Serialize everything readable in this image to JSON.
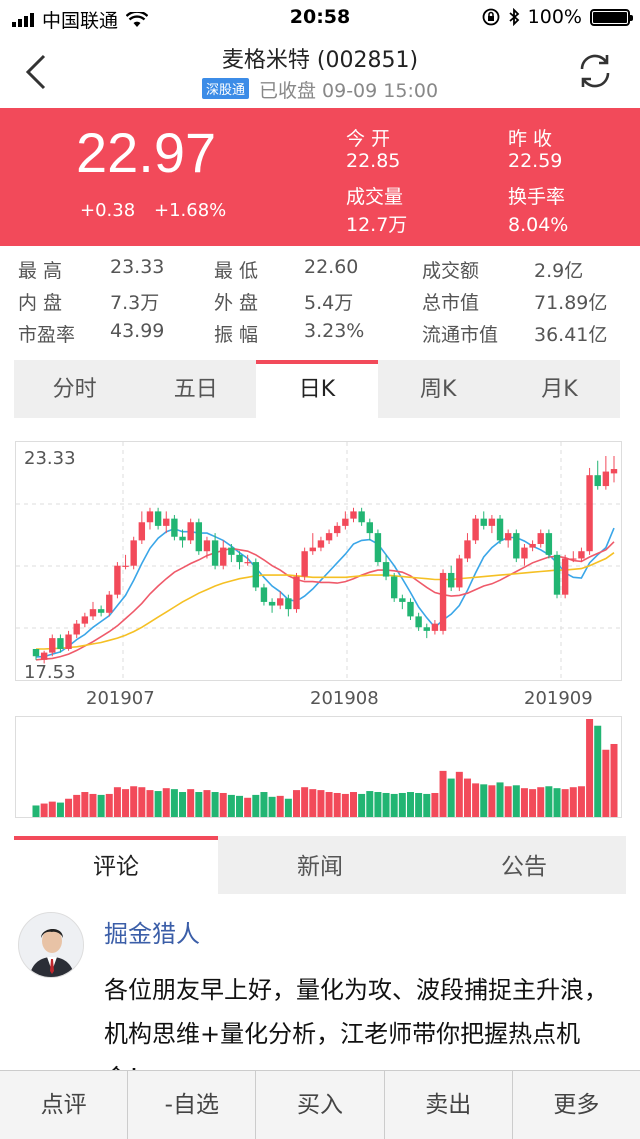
{
  "status_bar": {
    "carrier": "中国联通",
    "time": "20:58",
    "battery": "100%"
  },
  "header": {
    "title": "麦格米特 (002851)",
    "badge": "深股通",
    "subtitle": "已收盘 09-09 15:00"
  },
  "quote": {
    "price": "22.97",
    "change": "+0.38",
    "change_pct": "+1.68%",
    "open_label": "今 开",
    "open": "22.85",
    "prev_close_label": "昨 收",
    "prev_close": "22.59",
    "volume_label": "成交量",
    "volume": "12.7万",
    "turnover_label": "换手率",
    "turnover": "8.04%"
  },
  "stats": [
    {
      "label": "最 高",
      "value": "23.33"
    },
    {
      "label": "最 低",
      "value": "22.60"
    },
    {
      "label": "成交额",
      "value": "2.9亿"
    },
    {
      "label": "内 盘",
      "value": "7.3万"
    },
    {
      "label": "外 盘",
      "value": "5.4万"
    },
    {
      "label": "总市值",
      "value": "71.89亿"
    },
    {
      "label": "市盈率",
      "value": "43.99"
    },
    {
      "label": "振 幅",
      "value": "3.23%"
    },
    {
      "label": "流通市值",
      "value": "36.41亿"
    }
  ],
  "chart_tabs": [
    "分时",
    "五日",
    "日K",
    "周K",
    "月K"
  ],
  "chart_data": {
    "type": "candlestick",
    "y_max_label": "23.33",
    "y_min_label": "17.53",
    "ylim": [
      17.53,
      23.33
    ],
    "x_tick_labels": [
      "201907",
      "201908",
      "201909"
    ],
    "candles": [
      [
        18.0,
        17.8,
        17.9,
        17.7
      ],
      [
        17.7,
        17.9,
        17.95,
        17.6
      ],
      [
        17.9,
        18.3,
        18.4,
        17.8
      ],
      [
        18.3,
        18.0,
        18.4,
        17.9
      ],
      [
        18.0,
        18.4,
        18.5,
        17.95
      ],
      [
        18.4,
        18.7,
        18.8,
        18.3
      ],
      [
        18.7,
        18.9,
        19.0,
        18.6
      ],
      [
        18.9,
        19.1,
        19.3,
        18.8
      ],
      [
        19.1,
        19.0,
        19.2,
        18.9
      ],
      [
        19.0,
        19.5,
        19.6,
        18.9
      ],
      [
        19.5,
        20.3,
        20.4,
        19.4
      ],
      [
        20.3,
        20.3,
        20.6,
        20.2
      ],
      [
        20.3,
        21.0,
        21.1,
        20.2
      ],
      [
        21.0,
        21.5,
        21.8,
        20.9
      ],
      [
        21.5,
        21.8,
        21.9,
        21.3
      ],
      [
        21.8,
        21.4,
        21.9,
        21.3
      ],
      [
        21.4,
        21.6,
        21.8,
        21.2
      ],
      [
        21.6,
        21.1,
        21.7,
        21.0
      ],
      [
        21.1,
        21.0,
        21.3,
        20.8
      ],
      [
        21.0,
        21.5,
        21.6,
        20.9
      ],
      [
        21.5,
        20.7,
        21.6,
        20.6
      ],
      [
        20.7,
        21.0,
        21.1,
        20.5
      ],
      [
        21.0,
        20.3,
        21.2,
        20.2
      ],
      [
        20.3,
        20.8,
        21.0,
        20.2
      ],
      [
        20.8,
        20.6,
        20.9,
        20.4
      ],
      [
        20.6,
        20.4,
        20.7,
        20.2
      ],
      [
        20.4,
        20.4,
        20.6,
        20.3
      ],
      [
        20.4,
        19.7,
        20.5,
        19.6
      ],
      [
        19.7,
        19.3,
        19.8,
        19.2
      ],
      [
        19.3,
        19.2,
        19.4,
        19.0
      ],
      [
        19.2,
        19.4,
        19.6,
        19.1
      ],
      [
        19.4,
        19.1,
        19.5,
        18.9
      ],
      [
        19.1,
        20.0,
        20.1,
        19.0
      ],
      [
        20.0,
        20.7,
        20.8,
        19.9
      ],
      [
        20.7,
        20.8,
        21.2,
        20.6
      ],
      [
        20.8,
        21.0,
        21.1,
        20.7
      ],
      [
        21.0,
        21.2,
        21.3,
        20.9
      ],
      [
        21.2,
        21.4,
        21.5,
        21.1
      ],
      [
        21.4,
        21.6,
        21.8,
        21.3
      ],
      [
        21.6,
        21.8,
        21.9,
        21.5
      ],
      [
        21.8,
        21.5,
        21.9,
        21.4
      ],
      [
        21.5,
        21.2,
        21.6,
        21.0
      ],
      [
        21.2,
        20.4,
        21.3,
        20.3
      ],
      [
        20.4,
        20.0,
        20.6,
        19.9
      ],
      [
        20.0,
        19.4,
        20.1,
        19.3
      ],
      [
        19.4,
        19.3,
        19.5,
        19.1
      ],
      [
        19.3,
        18.9,
        19.4,
        18.8
      ],
      [
        18.9,
        18.6,
        19.0,
        18.5
      ],
      [
        18.6,
        18.5,
        18.7,
        18.3
      ],
      [
        18.5,
        18.7,
        18.8,
        18.4
      ],
      [
        18.5,
        20.1,
        20.2,
        18.4
      ],
      [
        20.1,
        19.7,
        20.3,
        19.6
      ],
      [
        19.7,
        20.5,
        20.6,
        19.6
      ],
      [
        20.5,
        21.0,
        21.2,
        20.4
      ],
      [
        21.0,
        21.6,
        21.7,
        20.9
      ],
      [
        21.6,
        21.4,
        21.8,
        21.3
      ],
      [
        21.4,
        21.6,
        21.7,
        21.2
      ],
      [
        21.6,
        21.0,
        21.7,
        20.9
      ],
      [
        21.0,
        21.2,
        21.3,
        20.8
      ],
      [
        21.2,
        20.5,
        21.3,
        20.4
      ],
      [
        20.5,
        20.8,
        20.9,
        20.3
      ],
      [
        20.8,
        20.9,
        21.0,
        20.7
      ],
      [
        20.9,
        21.2,
        21.3,
        20.8
      ],
      [
        21.2,
        20.6,
        21.3,
        20.5
      ],
      [
        20.6,
        19.5,
        20.7,
        19.4
      ],
      [
        19.5,
        20.5,
        20.6,
        19.4
      ],
      [
        20.5,
        20.5,
        20.7,
        20.4
      ],
      [
        20.5,
        20.7,
        20.8,
        20.4
      ],
      [
        20.7,
        22.8,
        23.0,
        20.6
      ],
      [
        22.8,
        22.5,
        23.2,
        22.4
      ],
      [
        22.5,
        22.9,
        23.33,
        22.4
      ],
      [
        22.85,
        22.97,
        23.33,
        22.6
      ]
    ],
    "ma_lines": [
      {
        "color": "#3aa6e8",
        "values": [
          17.78,
          17.79,
          17.86,
          17.92,
          18.08,
          18.26,
          18.4,
          18.6,
          18.76,
          18.92,
          19.2,
          19.48,
          19.9,
          20.36,
          20.78,
          21.06,
          21.24,
          21.32,
          21.24,
          21.24,
          21.2,
          21.2,
          21.1,
          21.0,
          20.84,
          20.66,
          20.5,
          20.24,
          19.98,
          19.74,
          19.58,
          19.36,
          19.32,
          19.46,
          19.66,
          19.9,
          20.14,
          20.38,
          20.62,
          20.9,
          21.0,
          21.02,
          20.9,
          20.6,
          20.3,
          19.94,
          19.56,
          19.16,
          18.86,
          18.6,
          18.8,
          18.96,
          19.2,
          19.62,
          20.1,
          20.54,
          20.8,
          20.98,
          21.08,
          21.08,
          20.98,
          20.84,
          20.74,
          20.6,
          20.38,
          20.1,
          19.98,
          19.96,
          20.38,
          20.6,
          20.8,
          21.34
        ]
      },
      {
        "color": "#ef5a6a",
        "values": [
          17.7,
          17.72,
          17.74,
          17.79,
          17.86,
          17.96,
          18.08,
          18.2,
          18.34,
          18.48,
          18.64,
          18.84,
          19.04,
          19.26,
          19.52,
          19.74,
          19.94,
          20.12,
          20.24,
          20.36,
          20.46,
          20.58,
          20.66,
          20.72,
          20.78,
          20.74,
          20.7,
          20.6,
          20.46,
          20.3,
          20.18,
          20.02,
          19.92,
          19.86,
          19.86,
          19.84,
          19.84,
          19.82,
          19.86,
          19.94,
          20.04,
          20.12,
          20.18,
          20.18,
          20.16,
          20.12,
          20.02,
          19.86,
          19.7,
          19.56,
          19.5,
          19.46,
          19.48,
          19.54,
          19.64,
          19.74,
          19.8,
          19.9,
          20.02,
          20.14,
          20.26,
          20.38,
          20.46,
          20.54,
          20.56,
          20.52,
          20.44,
          20.42,
          20.54,
          20.64,
          20.74,
          20.96
        ]
      },
      {
        "color": "#f5c024",
        "values": [
          18.0,
          18.0,
          18.01,
          18.02,
          18.04,
          18.06,
          18.1,
          18.14,
          18.18,
          18.24,
          18.3,
          18.38,
          18.48,
          18.6,
          18.74,
          18.88,
          19.02,
          19.16,
          19.3,
          19.42,
          19.54,
          19.64,
          19.74,
          19.82,
          19.88,
          19.94,
          19.98,
          20.02,
          20.04,
          20.04,
          20.04,
          20.04,
          20.02,
          20.0,
          19.98,
          19.98,
          19.98,
          19.98,
          19.98,
          20.0,
          20.02,
          20.04,
          20.04,
          20.04,
          20.02,
          20.0,
          19.98,
          19.96,
          19.94,
          19.92,
          19.92,
          19.92,
          19.94,
          19.96,
          19.98,
          20.0,
          20.02,
          20.04,
          20.06,
          20.08,
          20.1,
          20.12,
          20.14,
          20.16,
          20.18,
          20.18,
          20.2,
          20.22,
          20.3,
          20.4,
          20.5,
          20.66
        ]
      }
    ],
    "volume": [
      1.2,
      1.4,
      1.6,
      1.5,
      1.9,
      2.3,
      2.6,
      2.4,
      2.3,
      2.4,
      3.1,
      2.9,
      3.2,
      3.1,
      2.8,
      2.7,
      3.0,
      2.9,
      2.6,
      2.9,
      2.6,
      2.8,
      2.6,
      2.5,
      2.3,
      2.2,
      2.0,
      2.3,
      2.6,
      2.1,
      2.2,
      1.9,
      2.8,
      3.1,
      2.9,
      2.8,
      2.6,
      2.5,
      2.4,
      2.6,
      2.4,
      2.7,
      2.6,
      2.5,
      2.4,
      2.5,
      2.6,
      2.5,
      2.4,
      2.5,
      4.8,
      4.0,
      4.7,
      4.0,
      3.5,
      3.4,
      3.3,
      3.6,
      3.2,
      3.3,
      3.0,
      2.9,
      3.1,
      3.2,
      3.0,
      2.9,
      3.1,
      3.2,
      10.2,
      9.5,
      7.0,
      7.6
    ]
  },
  "comment_tabs": [
    "评论",
    "新闻",
    "公告"
  ],
  "comment": {
    "author": "掘金猎人",
    "text": "各位朋友早上好，量化为攻、波段捕捉主升浪，机构思维+量化分析，江老师带你把握热点机会！"
  },
  "bottom_bar": [
    "点评",
    "-自选",
    "买入",
    "卖出",
    "更多"
  ],
  "colors": {
    "up": "#f24a5a",
    "down": "#22b573",
    "header_red": "#f24a5a",
    "ma5": "#3aa6e8",
    "ma10": "#ef5a6a",
    "ma20": "#f5c024"
  }
}
